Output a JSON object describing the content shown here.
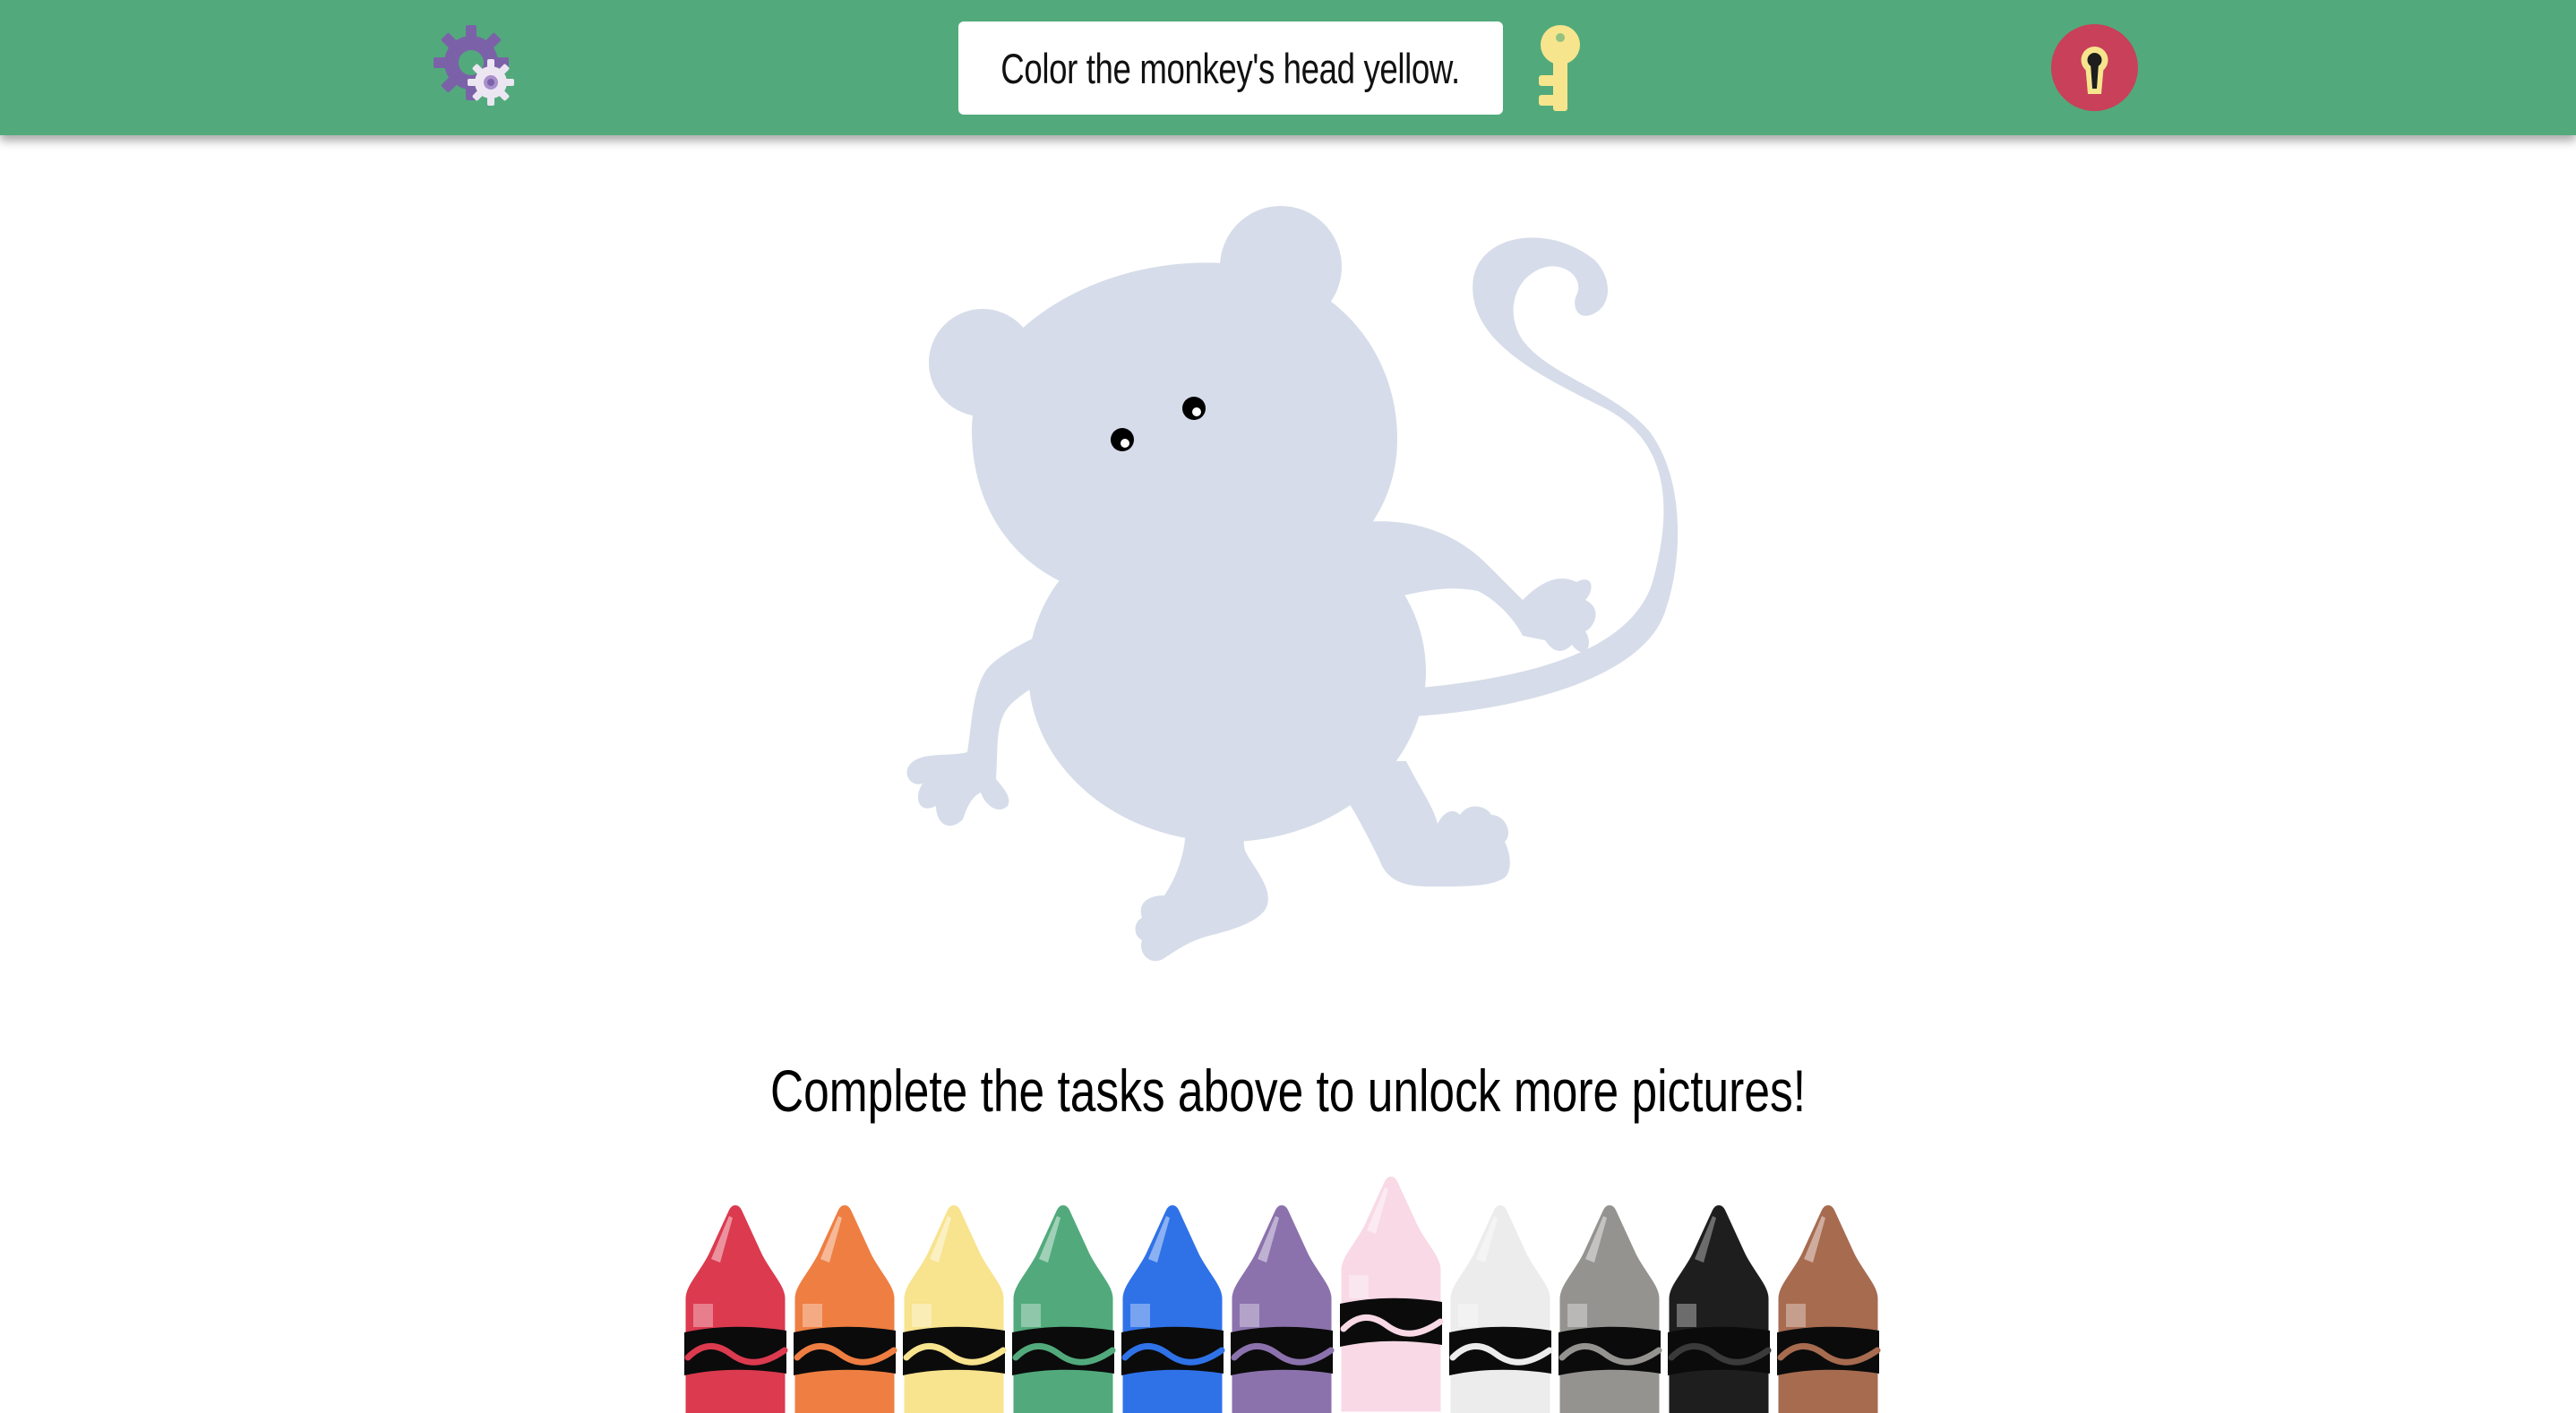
{
  "header": {
    "task_text": "Color the monkey's head yellow."
  },
  "icons": {
    "settings": "gear-icon",
    "key": "key-icon",
    "lock": "keyhole-lock-icon"
  },
  "picture": {
    "subject": "monkey",
    "fill_color": "#d6dce9"
  },
  "footer": {
    "message": "Complete the tasks above to unlock more pictures!"
  },
  "colors": {
    "topbar": "#52aa7c",
    "lock_button": "#c8405a",
    "key": "#f6e58d"
  },
  "palette": [
    {
      "name": "red",
      "color": "#dc3a4f",
      "selected": false
    },
    {
      "name": "orange",
      "color": "#ee7e42",
      "selected": false
    },
    {
      "name": "yellow",
      "color": "#f8e38e",
      "selected": false
    },
    {
      "name": "green",
      "color": "#52aa7c",
      "selected": false
    },
    {
      "name": "blue",
      "color": "#2f72e8",
      "selected": false
    },
    {
      "name": "purple",
      "color": "#8b72ad",
      "selected": false
    },
    {
      "name": "pink",
      "color": "#f8d9e5",
      "selected": true
    },
    {
      "name": "white",
      "color": "#ececec",
      "selected": false
    },
    {
      "name": "gray",
      "color": "#959390",
      "selected": false
    },
    {
      "name": "black",
      "color": "#1e1e1e",
      "selected": false
    },
    {
      "name": "brown",
      "color": "#a76b50",
      "selected": false
    }
  ]
}
